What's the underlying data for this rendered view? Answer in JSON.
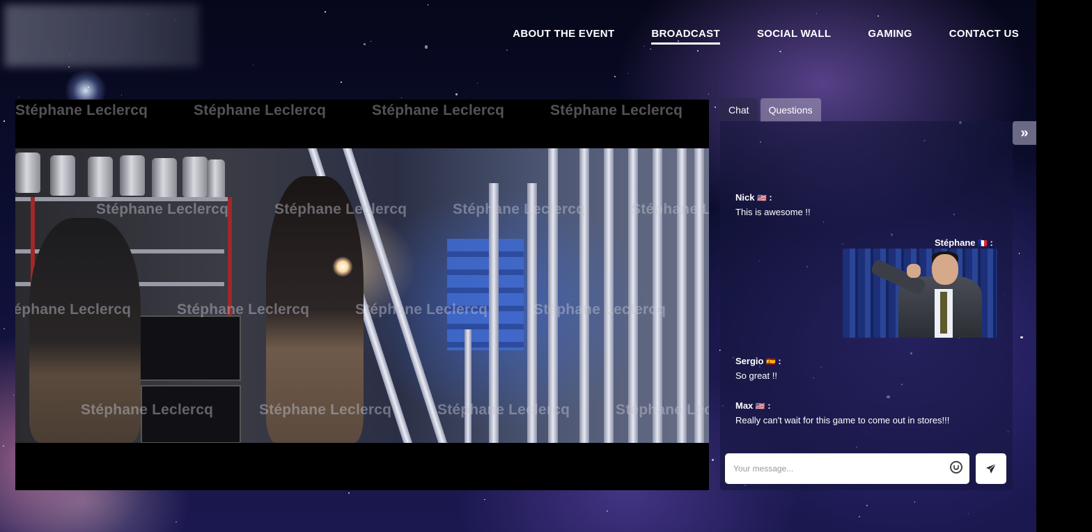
{
  "nav": {
    "items": [
      {
        "label": "ABOUT THE EVENT",
        "active": false
      },
      {
        "label": "BROADCAST",
        "active": true
      },
      {
        "label": "SOCIAL WALL",
        "active": false
      },
      {
        "label": "GAMING",
        "active": false
      },
      {
        "label": "CONTACT US",
        "active": false
      }
    ]
  },
  "player": {
    "watermark": "Stéphane Leclercq"
  },
  "chat": {
    "tabs": [
      {
        "label": "Chat",
        "active": true
      },
      {
        "label": "Questions",
        "active": false
      }
    ],
    "collapse_icon": "»",
    "messages": [
      {
        "author": "Nick",
        "flag": "🇺🇸",
        "sep": " :",
        "text": "This is awesome !!"
      },
      {
        "author": "Stéphane",
        "flag": "🇫🇷",
        "sep": " :",
        "text": "",
        "has_gif": true
      },
      {
        "author": "Sergio",
        "flag": "🇪🇸",
        "sep": " :",
        "text": "So great !!"
      },
      {
        "author": "Max",
        "flag": "🇺🇸",
        "sep": " :",
        "text": "Really can't wait for this game to come out in stores!!!"
      }
    ],
    "input_placeholder": "Your message...",
    "emoji_icon": "smiley-icon",
    "send_icon": "paper-plane-icon"
  }
}
